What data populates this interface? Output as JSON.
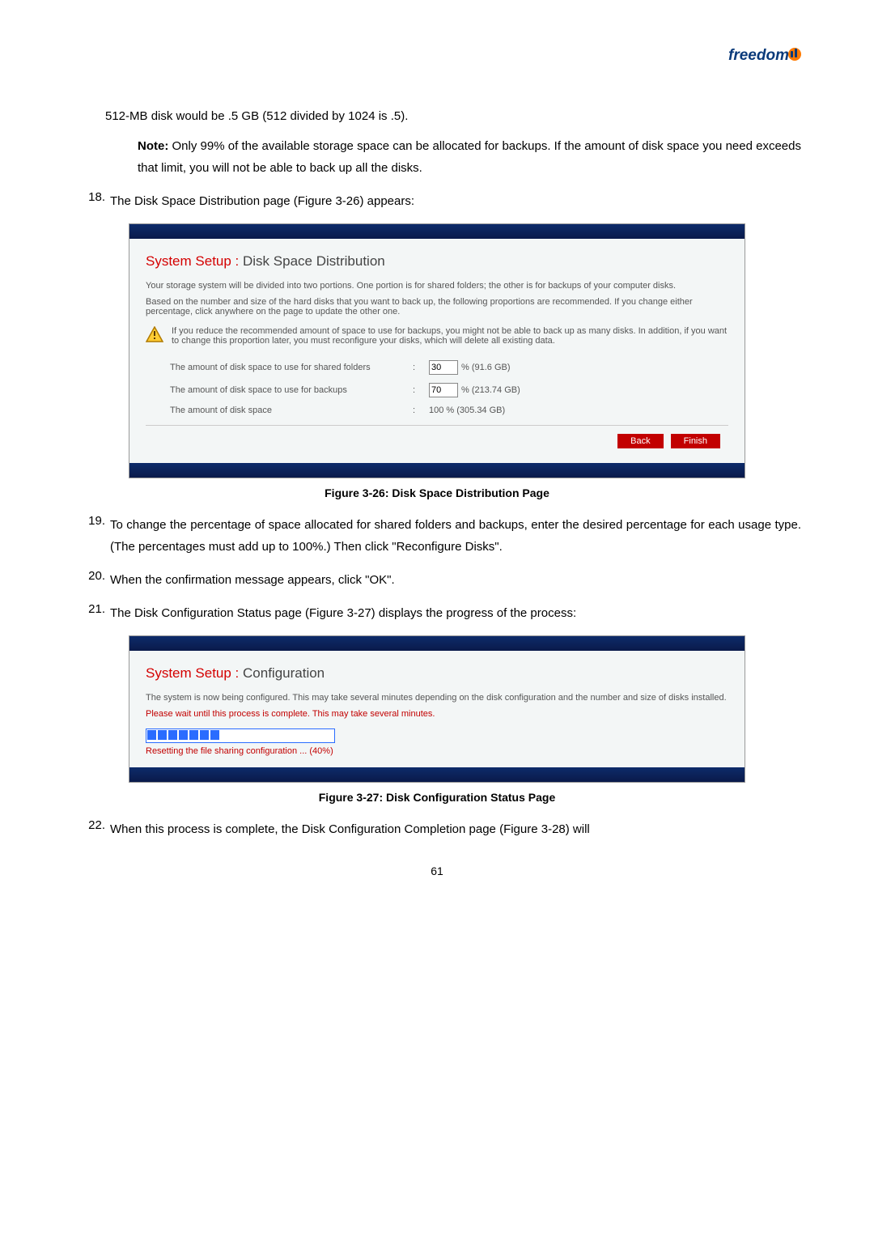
{
  "logo_text": "freedom",
  "p1": "512-MB disk would be .5 GB (512 divided by 1024 is .5).",
  "note_label": "Note: ",
  "note_text": "Only 99% of the available storage space can be allocated for backups. If the amount of disk space you need exceeds that limit, you will not be able to back up all the disks.",
  "step18_num": "18.",
  "step18_text": "The Disk Space Distribution page (Figure 3-26) appears:",
  "fig1": {
    "title_red": "System Setup :",
    "title_rest": " Disk Space Distribution",
    "p1": "Your storage system will be divided into two portions. One portion is for shared folders; the other is for backups of your computer disks.",
    "p2": "Based on the number and size of the hard disks that you want to back up, the following proportions are recommended. If you change either percentage, click anywhere on the page to update the other one.",
    "warn": "If you reduce the recommended amount of space to use for backups, you might not be able to back up as many disks. In addition, if you want to change this proportion later, you must reconfigure your disks, which will delete all existing data.",
    "row1_label": "The amount of disk space to use for shared folders",
    "row1_val_input": "30",
    "row1_val_text": "% (91.6 GB)",
    "row2_label": "The amount of disk space to use for backups",
    "row2_val_input": "70",
    "row2_val_text": "% (213.74 GB)",
    "row3_label": "The amount of disk space",
    "row3_val_text": "100 % (305.34 GB)",
    "btn_back": "Back",
    "btn_finish": "Finish"
  },
  "fig1_caption": "Figure 3-26: Disk Space Distribution Page",
  "step19_num": "19.",
  "step19_text": "To change the percentage of space allocated for shared folders and backups, enter the desired percentage for each usage type. (The percentages must add up to 100%.) Then click \"Reconfigure Disks\".",
  "step20_num": "20.",
  "step20_text": "When the confirmation message appears, click \"OK\".",
  "step21_num": "21.",
  "step21_text": "The Disk Configuration Status page (Figure 3-27) displays the progress of the process:",
  "fig2": {
    "title_red": "System Setup :",
    "title_rest": " Configuration",
    "p1": "The system is now being configured. This may take several minutes depending on the disk configuration and the number and size of disks installed.",
    "p2": "Please wait until this process is complete. This may take several minutes.",
    "progress_text": "Resetting the file sharing configuration ... (40%)"
  },
  "fig2_caption": "Figure 3-27: Disk Configuration Status Page",
  "step22_num": "22.",
  "step22_text": "When this process is complete, the Disk Configuration Completion page (Figure 3-28) will",
  "page_num": "61"
}
